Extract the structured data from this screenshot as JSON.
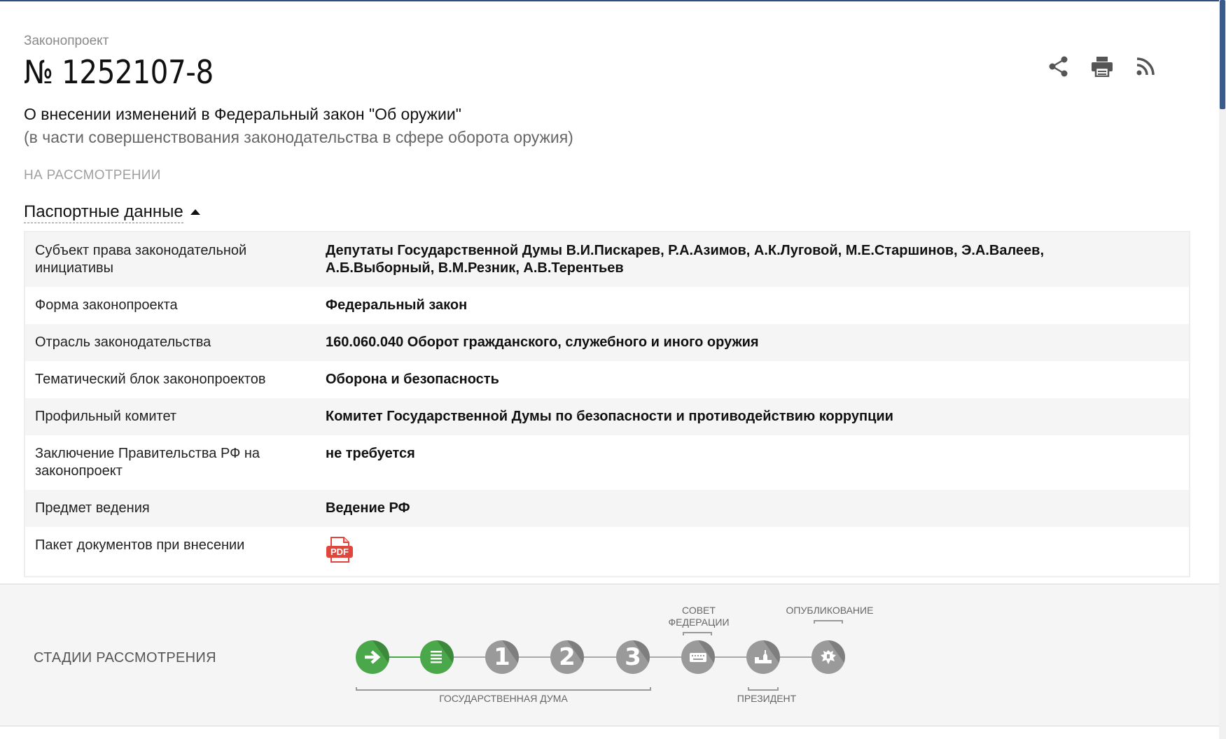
{
  "header": {
    "kicker": "Законопроект",
    "number": "№ 1252107-8",
    "title": "О внесении изменений в Федеральный закон \"Об оружии\"",
    "subtitle": "(в части совершенствования законодательства в сфере оборота оружия)",
    "status": "НА РАССМОТРЕНИИ"
  },
  "actions": [
    "share-icon",
    "print-icon",
    "rss-icon"
  ],
  "passport": {
    "title": "Паспортные данные",
    "rows": [
      {
        "key": "Субъект права законодательной инициативы",
        "value": "Депутаты Государственной Думы В.И.Пискарев, Р.А.Азимов, А.К.Луговой, М.Е.Старшинов, Э.А.Валеев, А.Б.Выборный, В.М.Резник, А.В.Терентьев"
      },
      {
        "key": "Форма законопроекта",
        "value": "Федеральный закон"
      },
      {
        "key": "Отрасль законодательства",
        "value": "160.060.040 Оборот гражданского, служебного и иного оружия"
      },
      {
        "key": "Тематический блок законопроектов",
        "value": "Оборона и безопасность"
      },
      {
        "key": "Профильный комитет",
        "value": "Комитет Государственной Думы по безопасности и противодействию коррупции"
      },
      {
        "key": "Заключение Правительства РФ на законопроект",
        "value": "не требуется"
      },
      {
        "key": "Предмет ведения",
        "value": "Ведение РФ"
      },
      {
        "key": "Пакет документов при внесении",
        "value": ""
      }
    ],
    "pdf_label": "PDF"
  },
  "stages": {
    "label": "СТАДИИ РАССМОТРЕНИЯ",
    "items": [
      {
        "icon": "arrow-icon",
        "state": "done"
      },
      {
        "icon": "list-icon",
        "state": "done"
      },
      {
        "number": "1",
        "state": "pending"
      },
      {
        "number": "2",
        "state": "pending"
      },
      {
        "number": "3",
        "state": "pending"
      },
      {
        "icon": "keyboard-icon",
        "state": "pending"
      },
      {
        "icon": "kremlin-icon",
        "state": "pending"
      },
      {
        "icon": "emblem-icon",
        "state": "pending"
      }
    ],
    "captions": {
      "duma": "ГОСУДАРСТВЕННАЯ ДУМА",
      "federation_council": "СОВЕТ ФЕДЕРАЦИИ",
      "president": "ПРЕЗИДЕНТ",
      "publication": "ОПУБЛИКОВАНИЕ"
    }
  },
  "colors": {
    "accent": "#2f4d7d",
    "done": "#4aa84a",
    "pending": "#9a9a9a",
    "pdf": "#e0473c"
  }
}
